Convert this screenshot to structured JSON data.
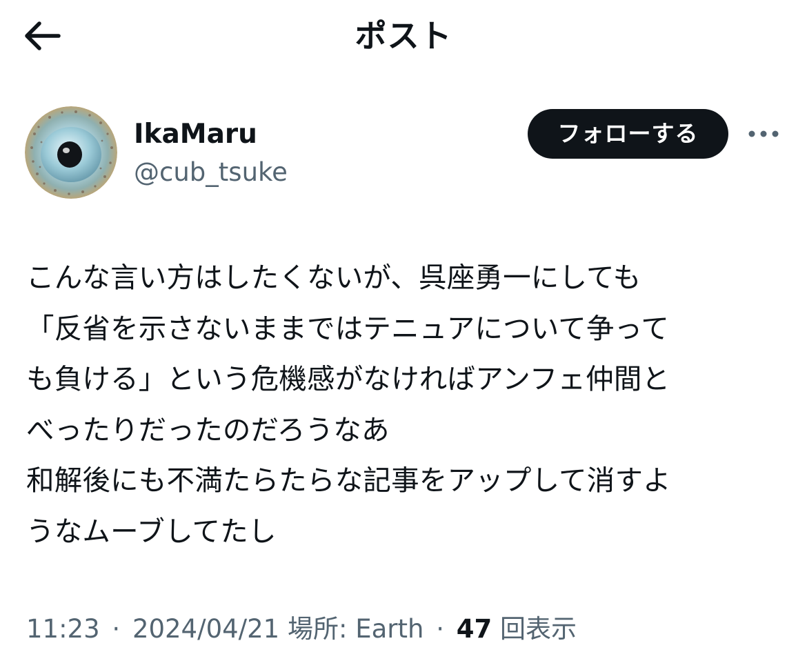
{
  "header": {
    "title": "ポスト",
    "back_icon": "arrow-left-icon"
  },
  "author": {
    "display_name": "IkaMaru",
    "handle": "@cub_tsuke",
    "follow_label": "フォローする",
    "more_icon": "ellipsis-icon"
  },
  "post": {
    "lines": [
      "こんな言い方はしたくないが、呉座勇一にしても",
      "「反省を示さないままではテニュアについて争って",
      "も負ける」という危機感がなければアンフェ仲間と",
      "べったりだったのだろうなあ",
      "和解後にも不満たらたらな記事をアップして消すよ",
      "うなムーブしてたし"
    ]
  },
  "meta": {
    "time": "11:23",
    "separator": "·",
    "date": "2024/04/21",
    "location": "場所: Earth",
    "views_count": "47",
    "views_label": "回表示"
  },
  "colors": {
    "text_primary": "#0f1419",
    "text_secondary": "#536471",
    "follow_bg": "#0f1419"
  }
}
